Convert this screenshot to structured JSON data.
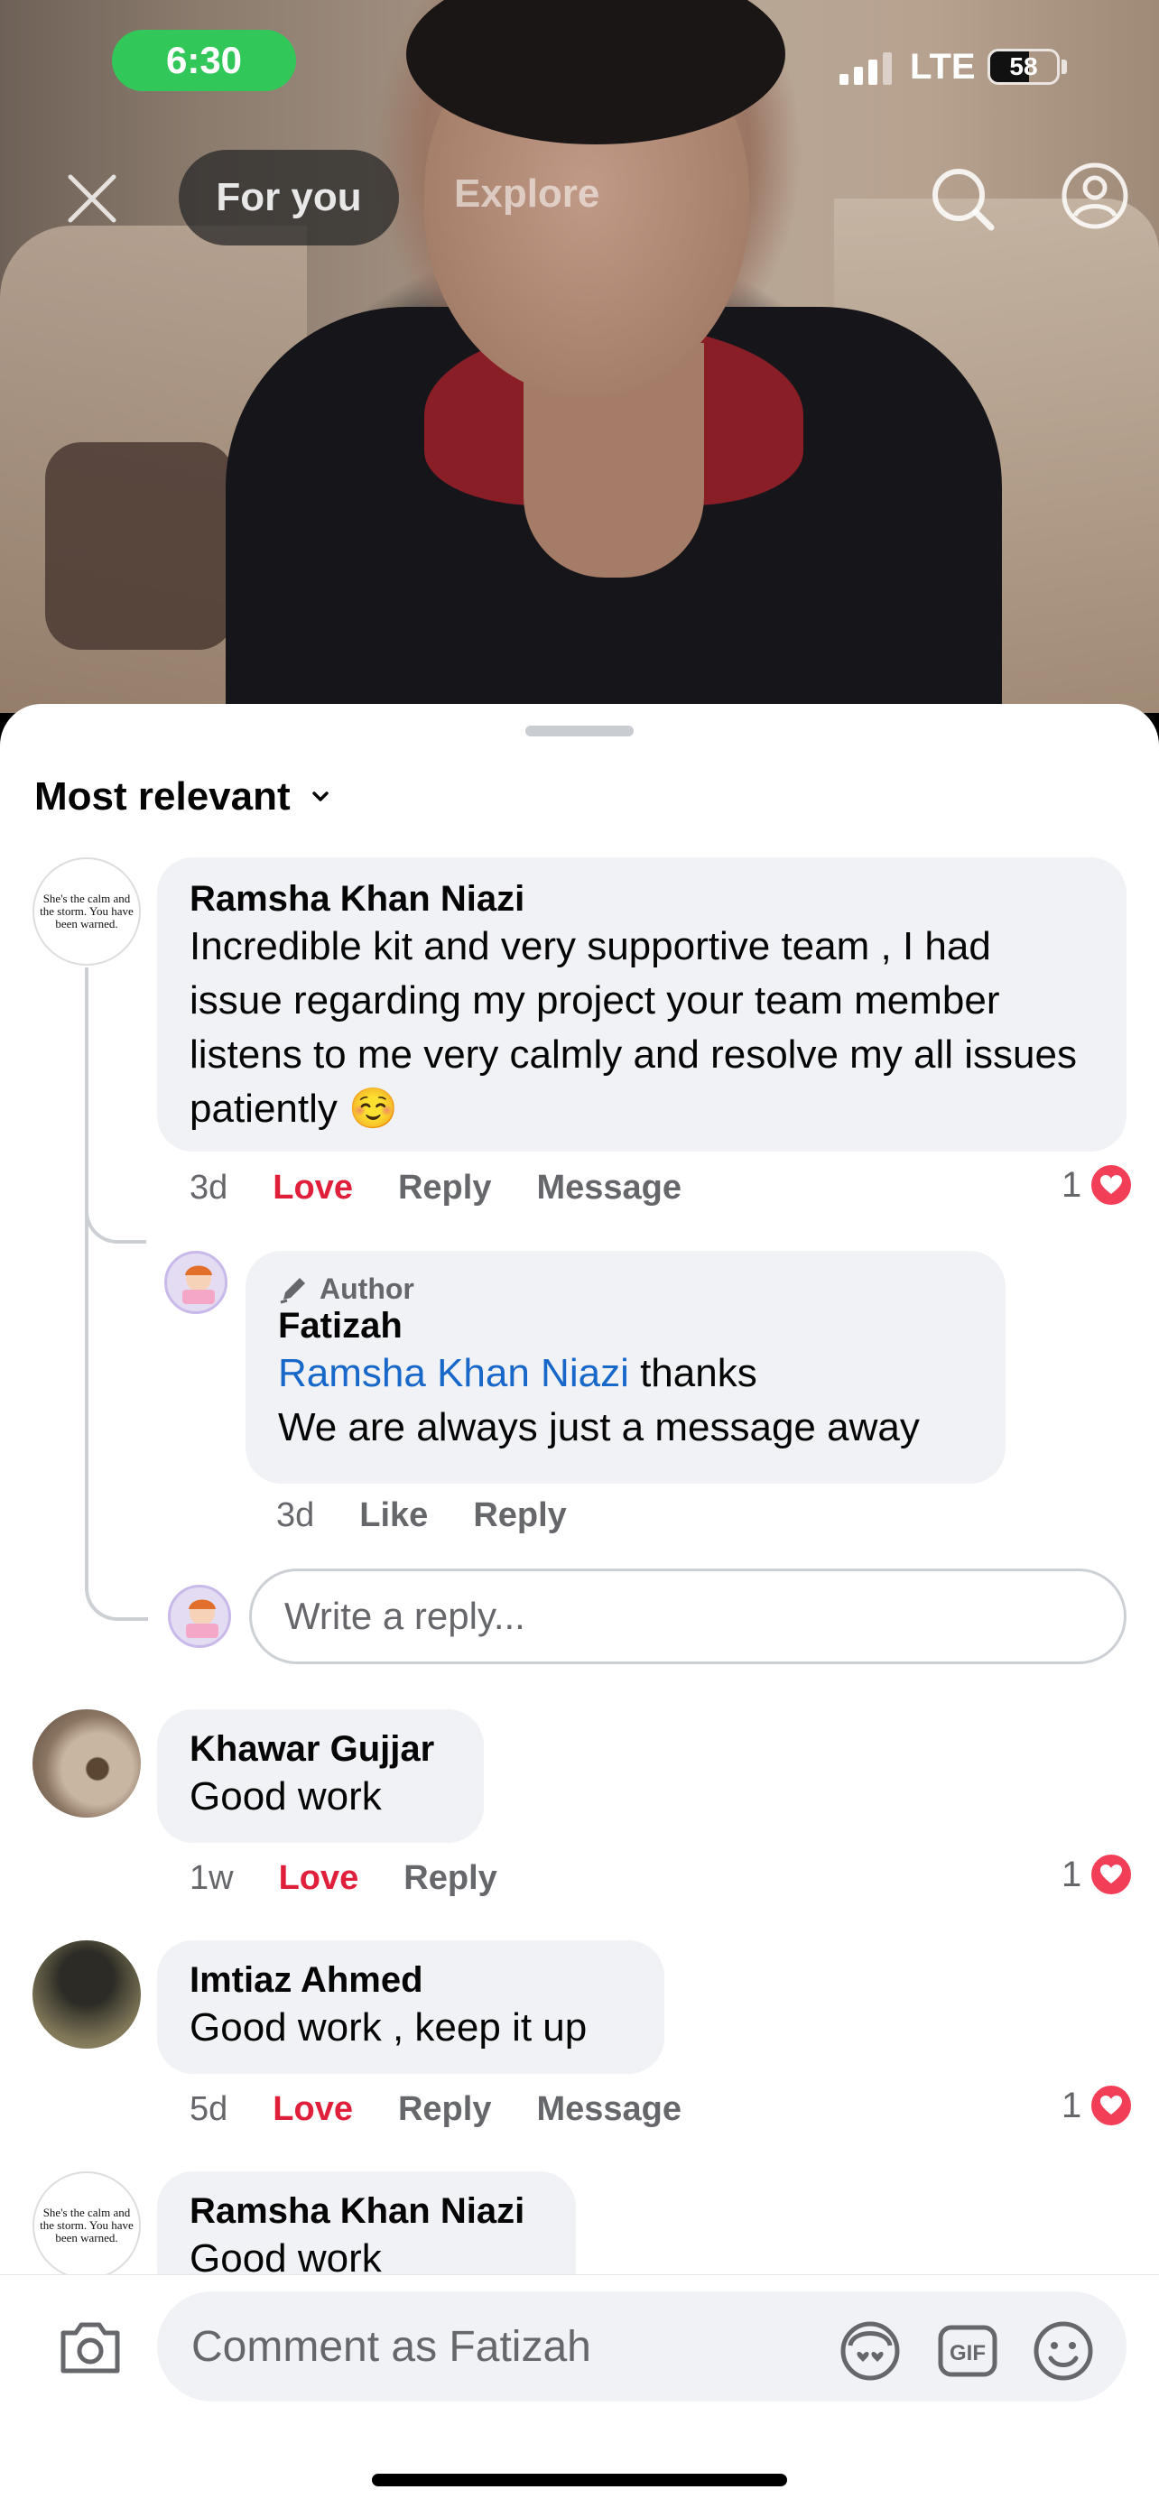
{
  "status": {
    "time": "6:30",
    "network": "LTE",
    "battery": "58",
    "battery_level": 0.58
  },
  "nav": {
    "tabs": [
      "For you",
      "Explore"
    ],
    "active_tab": "For you"
  },
  "sort": {
    "label": "Most relevant"
  },
  "comments": [
    {
      "author": "Ramsha Khan Niazi",
      "avatar_text": "She's the calm and the storm. You have been warned.",
      "text": "Incredible kit and very supportive team , I had issue  regarding my project your team member listens to me very calmly and resolve my all issues patiently ☺️",
      "time": "3d",
      "love": "Love",
      "reply": "Reply",
      "message": "Message",
      "reactions": "1"
    },
    {
      "author": "Khawar Gujjar",
      "text": "Good work",
      "time": "1w",
      "love": "Love",
      "reply": "Reply",
      "reactions": "1"
    },
    {
      "author": "Imtiaz Ahmed",
      "text": "Good work , keep it up",
      "time": "5d",
      "love": "Love",
      "reply": "Reply",
      "message": "Message",
      "reactions": "1"
    },
    {
      "author": "Ramsha Khan Niazi",
      "avatar_text": "She's the calm and the storm. You have been warned.",
      "text": "Good work"
    }
  ],
  "reply": {
    "badge": "Author",
    "author": "Fatizah",
    "mention": "Ramsha Khan Niazi",
    "mention_suffix": " thanks",
    "line2": "We are always just a message away",
    "time": "3d",
    "like": "Like",
    "reply": "Reply"
  },
  "reply_input": {
    "placeholder": "Write a reply..."
  },
  "composer": {
    "placeholder": "Comment as Fatizah"
  },
  "colors": {
    "love": "#e0203a",
    "mention": "#1868c9",
    "time_pill": "#32c759",
    "heart": "#f33e58"
  },
  "icons": [
    "close-icon",
    "search-icon",
    "profile-icon",
    "chevron-down-icon",
    "pencil-icon",
    "heart-icon",
    "camera-icon",
    "avatar-sticker-icon",
    "gif-icon",
    "emoji-icon"
  ]
}
